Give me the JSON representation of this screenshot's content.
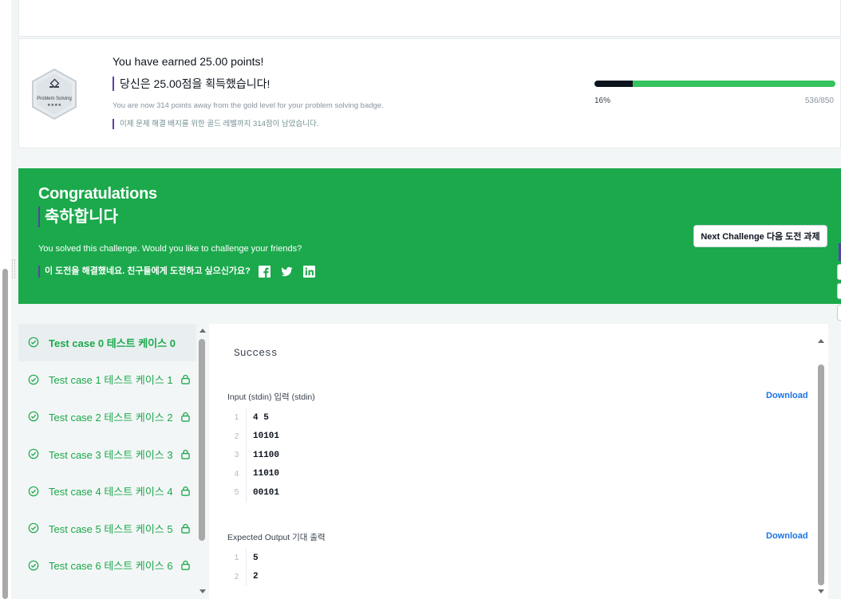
{
  "points": {
    "title": "You have earned 25.00 points!",
    "title_ko": "당신은 25.00점을 획득했습니다!",
    "subtitle": "You are now 314 points away from the gold level for your problem solving badge.",
    "subtitle_ko": "이제 문제 해결 배지를 위한 골드 레벨까지 314점이 남았습니다.",
    "badge_label": "Problem Solving",
    "badge_stars": "★★★★",
    "progress_percent": "16%",
    "progress_count": "536/850",
    "progress_fraction": 0.16
  },
  "congrats": {
    "title": "Congratulations",
    "title_ko": "축하합니다",
    "message": "You solved this challenge. Would you like to challenge your friends?",
    "message_ko": "이 도전을 해결했네요. 친구들에게 도전하고 싶으신가요?",
    "next_button": "Next Challenge 다음 도전 과제",
    "social_icons": [
      "facebook-icon",
      "twitter-icon",
      "linkedin-icon"
    ]
  },
  "test_cases": [
    {
      "label": "Test case 0 테스트 케이스 0",
      "locked": false,
      "active": true
    },
    {
      "label": "Test case 1 테스트 케이스 1",
      "locked": true,
      "active": false
    },
    {
      "label": "Test case 2 테스트 케이스 2",
      "locked": true,
      "active": false
    },
    {
      "label": "Test case 3 테스트 케이스 3",
      "locked": true,
      "active": false
    },
    {
      "label": "Test case 4 테스트 케이스 4",
      "locked": true,
      "active": false
    },
    {
      "label": "Test case 5 테스트 케이스 5",
      "locked": true,
      "active": false
    },
    {
      "label": "Test case 6 테스트 케이스 6",
      "locked": true,
      "active": false
    }
  ],
  "output": {
    "status": "Success",
    "input_label": "Input (stdin) 입력 (stdin)",
    "input_download": "Download",
    "input_lines": [
      {
        "n": "1",
        "v": "4 5"
      },
      {
        "n": "2",
        "v": "10101"
      },
      {
        "n": "3",
        "v": "11100"
      },
      {
        "n": "4",
        "v": "11010"
      },
      {
        "n": "5",
        "v": "00101"
      }
    ],
    "expected_label": "Expected Output 기대 출력",
    "expected_download": "Download",
    "expected_lines": [
      {
        "n": "1",
        "v": "5"
      },
      {
        "n": "2",
        "v": "2"
      }
    ]
  },
  "colors": {
    "green": "#1ba94c",
    "progress_green": "#34c35f",
    "dark": "#0e141e",
    "link_blue": "#1a73e8",
    "purple_marker": "#5b3fa8"
  }
}
